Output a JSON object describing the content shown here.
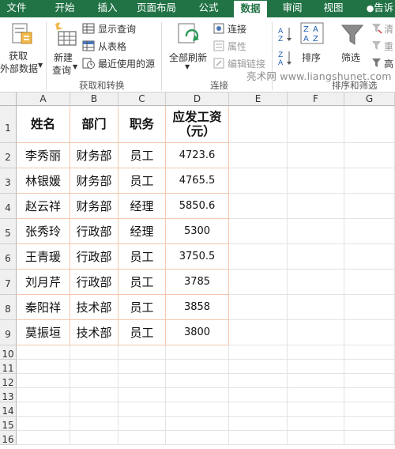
{
  "ribbon": {
    "tabs": [
      "文件",
      "开始",
      "插入",
      "页面布局",
      "公式",
      "数据",
      "审阅",
      "视图",
      "告诉"
    ],
    "active_tab": "数据",
    "get_external": [
      "获取",
      "外部数据"
    ],
    "new_query": [
      "新建",
      "查询"
    ],
    "show_queries": "显示查询",
    "from_table": "从表格",
    "recent_sources": "最近使用的源",
    "group_get_transform": "获取和转换",
    "refresh_all": "全部刷新",
    "connections": "连接",
    "properties": "属性",
    "edit_links": "编辑链接",
    "group_connections": "连接",
    "sort": "排序",
    "filter": "筛选",
    "clear": "清",
    "reapply": "重",
    "advanced": "高",
    "group_sort_filter": "排序和筛选",
    "watermark": "亮术网 www.liangshunet.com"
  },
  "sheet": {
    "columns": [
      "A",
      "B",
      "C",
      "D",
      "E",
      "F",
      "G"
    ],
    "rows": [
      "1",
      "2",
      "3",
      "4",
      "5",
      "6",
      "7",
      "8",
      "9",
      "10",
      "11",
      "12",
      "13",
      "14",
      "15",
      "16"
    ],
    "header": [
      "姓名",
      "部门",
      "职务",
      "应发工资（元）"
    ],
    "header_d_lines": [
      "应发工资",
      "（元）"
    ],
    "data": [
      [
        "李秀丽",
        "财务部",
        "员工",
        "4723.6"
      ],
      [
        "林银媛",
        "财务部",
        "员工",
        "4765.5"
      ],
      [
        "赵云祥",
        "财务部",
        "经理",
        "5850.6"
      ],
      [
        "张秀玲",
        "行政部",
        "经理",
        "5300"
      ],
      [
        "王青瑗",
        "行政部",
        "员工",
        "3750.5"
      ],
      [
        "刘月芹",
        "行政部",
        "员工",
        "3785"
      ],
      [
        "秦阳祥",
        "技术部",
        "员工",
        "3858"
      ],
      [
        "莫振垣",
        "技术部",
        "员工",
        "3800"
      ]
    ]
  },
  "colors": {
    "accent": "#217346",
    "table_border": "#f3c8ad"
  }
}
